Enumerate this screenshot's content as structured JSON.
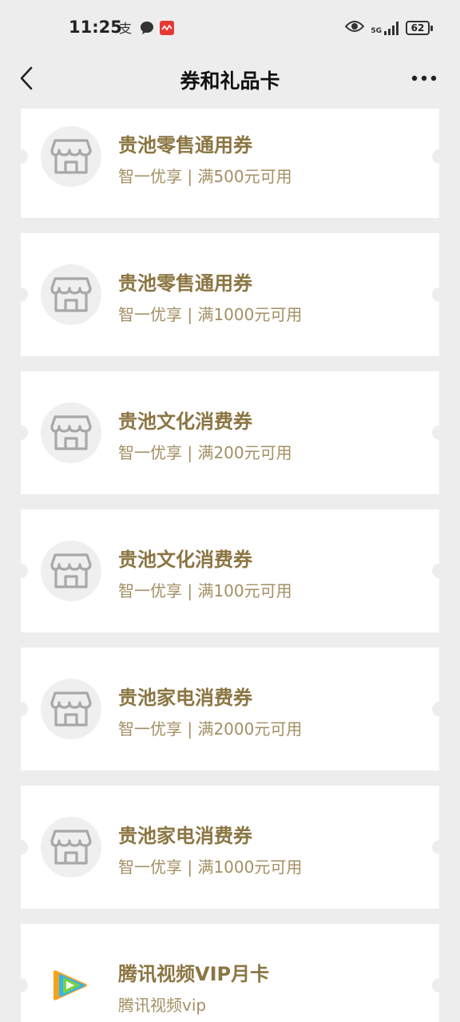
{
  "status_bar": {
    "time": "11:25",
    "network": "5G",
    "battery": "62"
  },
  "header": {
    "title": "券和礼品卡"
  },
  "cards": [
    {
      "title": "贵池零售通用券",
      "subtitle": "智一优享 | 满500元可用",
      "icon": "store-icon"
    },
    {
      "title": "贵池零售通用券",
      "subtitle": "智一优享 | 满1000元可用",
      "icon": "store-icon"
    },
    {
      "title": "贵池文化消费券",
      "subtitle": "智一优享 | 满200元可用",
      "icon": "store-icon"
    },
    {
      "title": "贵池文化消费券",
      "subtitle": "智一优享 | 满100元可用",
      "icon": "store-icon"
    },
    {
      "title": "贵池家电消费券",
      "subtitle": "智一优享 | 满2000元可用",
      "icon": "store-icon"
    },
    {
      "title": "贵池家电消费券",
      "subtitle": "智一优享 | 满1000元可用",
      "icon": "store-icon"
    },
    {
      "title": "腾讯视频VIP月卡",
      "subtitle": "腾讯视频vip",
      "icon": "tencent-video-icon"
    }
  ],
  "colors": {
    "background": "#ededed",
    "card": "#ffffff",
    "title": "#8b7542",
    "subtitle": "#a38f63"
  }
}
